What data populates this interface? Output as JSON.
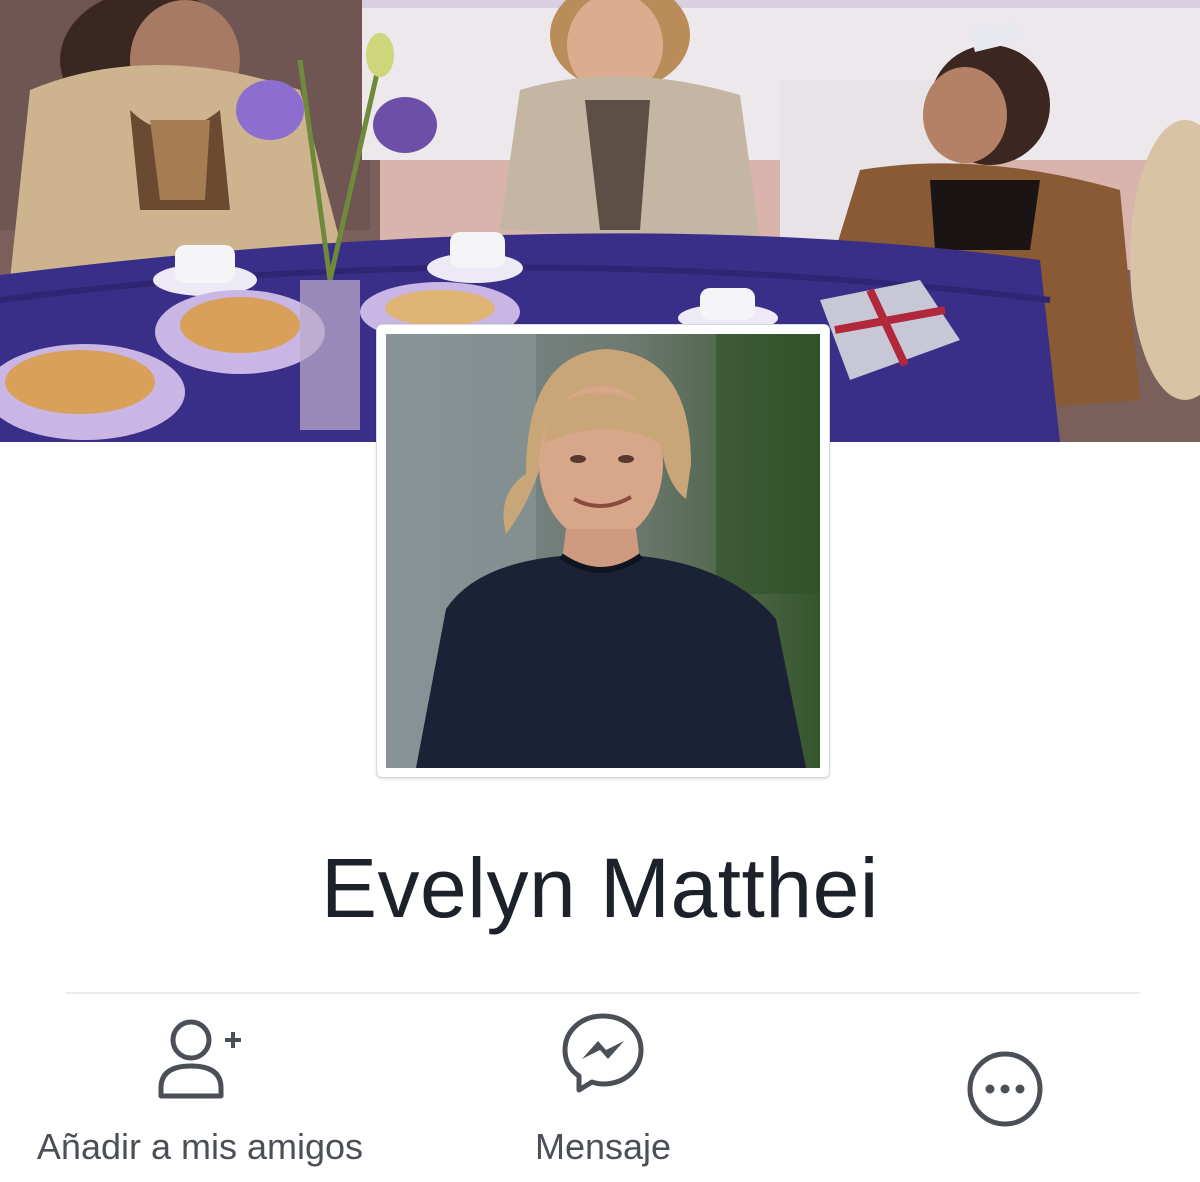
{
  "profile": {
    "name": "Evelyn Matthei"
  },
  "actions": {
    "add_friend_label": "Añadir a mis amigos",
    "message_label": "Mensaje"
  },
  "icons": {
    "add_friend": "add-friend-icon",
    "message": "messenger-icon",
    "more": "more-options-icon"
  },
  "colors": {
    "text_primary": "#1d2129",
    "icon_gray": "#4b4f56",
    "divider": "#e9ebee"
  }
}
